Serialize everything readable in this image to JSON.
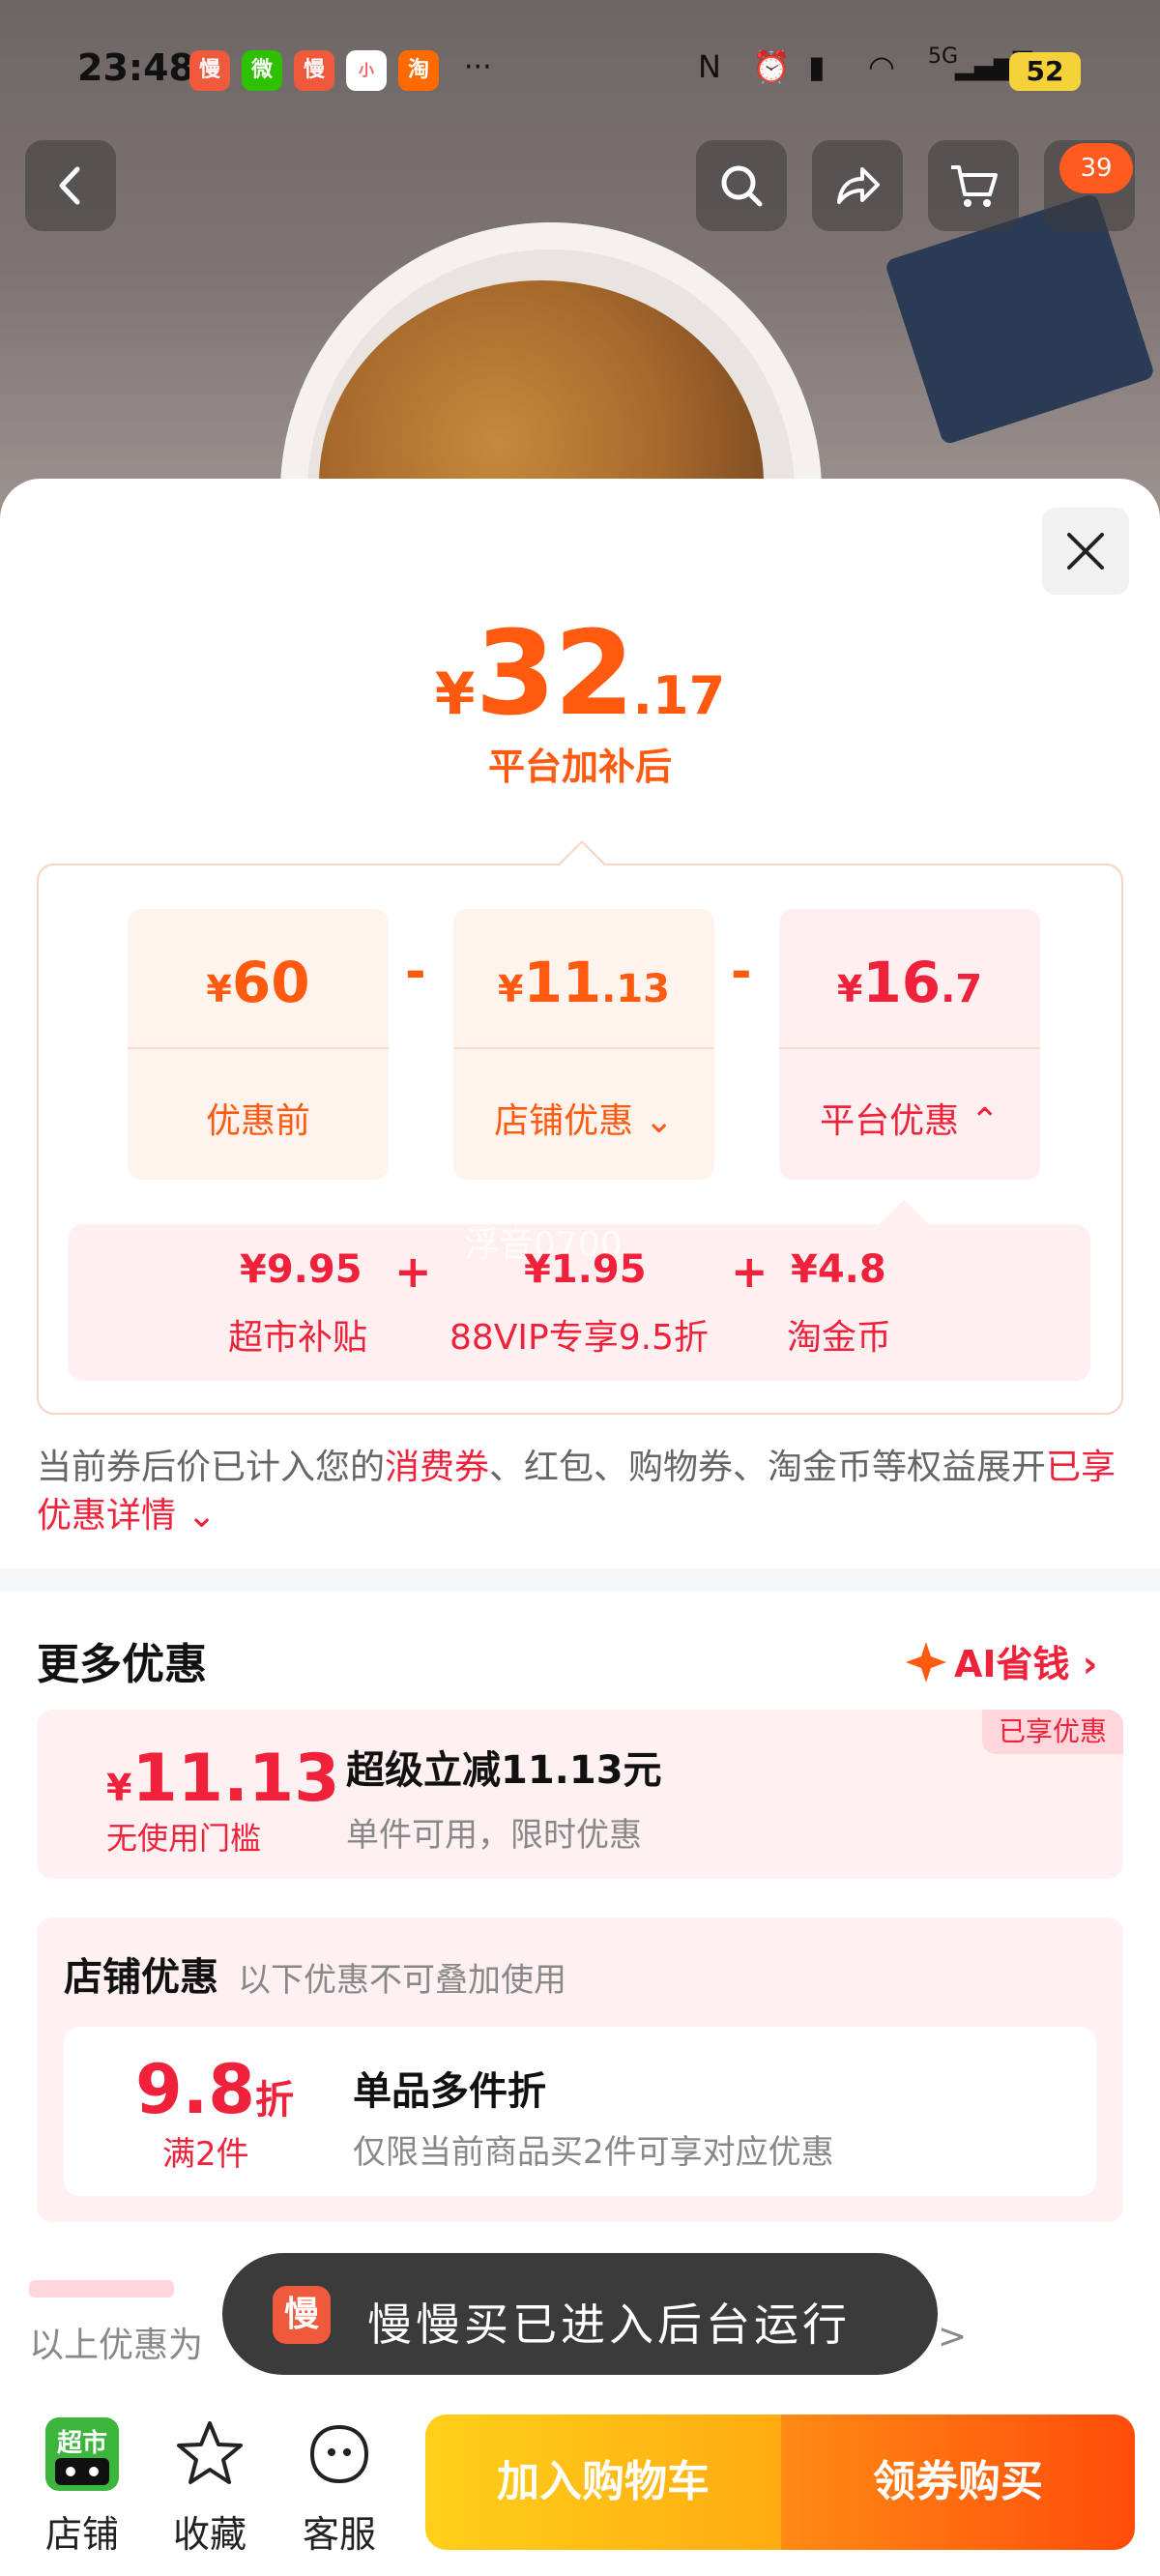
{
  "status_bar": {
    "time": "23:48",
    "apps": [
      "慢",
      "微",
      "慢",
      "小",
      "淘"
    ],
    "more": "···",
    "signal": "5G",
    "battery": "52"
  },
  "header": {
    "cart_badge": "39"
  },
  "price": {
    "currency": "¥",
    "integer": "32",
    "decimal": ".17",
    "label": "平台加补后"
  },
  "calc": {
    "boxes": [
      {
        "currency": "¥",
        "integer": "60",
        "decimal": "",
        "label": "优惠前"
      },
      {
        "currency": "¥",
        "integer": "11",
        "decimal": ".13",
        "label": "店铺优惠"
      },
      {
        "currency": "¥",
        "integer": "16",
        "decimal": ".7",
        "label": "平台优惠"
      }
    ],
    "operator": "-",
    "breakdown": [
      {
        "value": "¥9.95",
        "label": "超市补贴"
      },
      {
        "value": "¥1.95",
        "label": "88VIP专享9.5折"
      },
      {
        "value": "¥4.8",
        "label": "淘金币"
      }
    ],
    "plus": "+",
    "watermark": "浮音0700"
  },
  "note": {
    "part1": "当前券后价已计入您的",
    "hl1": "消费券",
    "part2": "、红包、购物券、淘金币等权益展开",
    "hl2": "已享优惠详情"
  },
  "more": {
    "title": "更多优惠",
    "ai_label": "AI省钱",
    "coupon": {
      "tag": "已享优惠",
      "currency": "¥",
      "amount": "11.13",
      "threshold": "无使用门槛",
      "title": "超级立减11.13元",
      "desc": "单件可用，限时优惠"
    }
  },
  "store": {
    "title": "店铺优惠",
    "note": "以下优惠不可叠加使用",
    "item": {
      "discount": "9.8",
      "unit": "折",
      "condition": "满2件",
      "title": "单品多件折",
      "desc": "仅限当前商品买2件可享对应优惠"
    }
  },
  "footer_note": "以上优惠为",
  "footer_arrow": ">",
  "toast": {
    "icon": "慢",
    "text": "慢慢买已进入后台运行"
  },
  "bottom_bar": {
    "shop_icon_text": "超市",
    "shop": "店铺",
    "fav": "收藏",
    "service": "客服",
    "add_cart": "加入购物车",
    "buy": "领券购买"
  },
  "colors": {
    "orange": "#ff5a10",
    "red": "#f0213a"
  }
}
